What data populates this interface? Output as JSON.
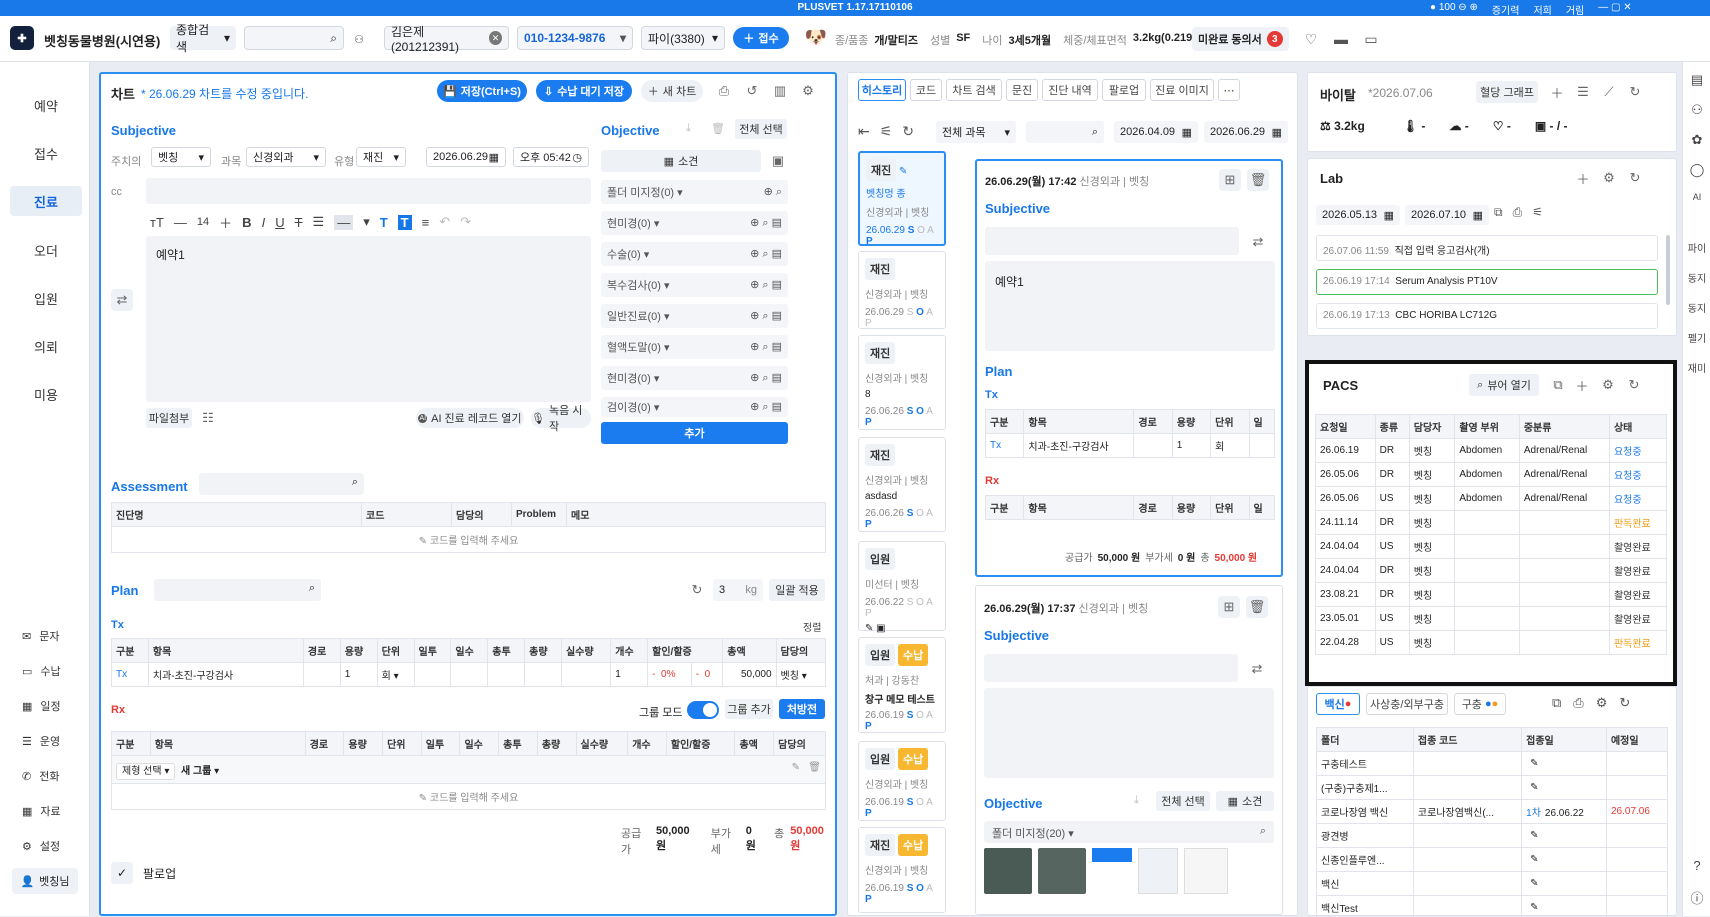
{
  "title_bar": {
    "app": "PLUSVET 1.17.17110106",
    "zoom": "100",
    "items": [
      "증기력",
      "저희",
      "거림"
    ]
  },
  "top": {
    "hospital": "벳칭동물병원(시연용)",
    "search_scope": "종합검색",
    "client": "김은제(201212391)",
    "phone": "010-1234-9876",
    "pet": "파이(3380)",
    "reception_btn": "접수",
    "species_label": "종/품종",
    "species": "개/말티즈",
    "sex_label": "성별",
    "sex": "SF",
    "age_label": "나이",
    "age": "3세5개월",
    "weight_label": "체중/체표면적",
    "weight": "3.2kg(0.219)",
    "consent_label": "미완료 동의서",
    "consent_count": "3"
  },
  "nav": {
    "items": [
      "예약",
      "접수",
      "진료",
      "오더",
      "입원",
      "의뢰",
      "미용"
    ],
    "sub": [
      "문자",
      "수납",
      "일정",
      "운영",
      "전화",
      "자료",
      "설정"
    ],
    "user": "벳칭님"
  },
  "chart": {
    "title": "차트",
    "edit_note": "* 26.06.29 차트를 수정 중입니다.",
    "save": "저장(Ctrl+S)",
    "save_wait": "수납 대기 저장",
    "new": "새 차트",
    "subjective": "Subjective",
    "doc_label": "주치의",
    "doc": "벳칭",
    "dept_label": "과목",
    "dept": "신경외과",
    "type_label": "유형",
    "type": "재진",
    "date": "2026.06.29",
    "time": "오후 05:42",
    "cc": "cc",
    "font_size": "14",
    "body": "예약1",
    "attach": "파일첨부",
    "ai_btn": "AI 진료 레코드 열기",
    "rec_btn": "녹음 시작",
    "objective": "Objective",
    "select_all": "전체 선택",
    "findings": "소견",
    "obj_rows": [
      "폴더 미지정(0)",
      "현미경(0)",
      "수술(0)",
      "복수검사(0)",
      "일반진료(0)",
      "혈액도말(0)",
      "현미경(0)",
      "검이경(0)"
    ],
    "add": "추가",
    "assessment": "Assessment",
    "a_cols": [
      "진단명",
      "코드",
      "담당의",
      "Problem",
      "메모"
    ],
    "a_placeholder": "코드를 입력해 주세요",
    "plan": "Plan",
    "plan_kg_val": "3",
    "plan_kg": "kg",
    "bulk": "일괄 적용",
    "tx": "Tx",
    "sort": "정렬",
    "tx_cols": [
      "구분",
      "항목",
      "경로",
      "용량",
      "단위",
      "일투",
      "일수",
      "총투",
      "총량",
      "실수량",
      "개수",
      "할인/할증",
      "총액",
      "담당의"
    ],
    "tx_row": {
      "type": "Tx",
      "item": "치과-초진-구강검사",
      "qty": "1",
      "unit": "회",
      "count": "1",
      "disc1": "-",
      "disc1_v": "0%",
      "disc2": "-",
      "disc2_v": "0",
      "total": "50,000",
      "doctor": "벳칭"
    },
    "rx": "Rx",
    "group_mode": "그룹 모드",
    "group_add": "그룹 추가",
    "prescription": "처방전",
    "rx_cols": [
      "구분",
      "항목",
      "경로",
      "용량",
      "단위",
      "일투",
      "일수",
      "총투",
      "총량",
      "실수량",
      "개수",
      "할인/할증",
      "총액",
      "담당의"
    ],
    "rx_group_sel": "제형 선택",
    "rx_group": "새 그룹",
    "rx_placeholder": "코드를 입력해 주세요",
    "supply_label": "공급가",
    "supply": "50,000 원",
    "vat_label": "부가세",
    "vat": "0 원",
    "total_label": "총",
    "total": "50,000 원",
    "followup": "팔로업"
  },
  "history": {
    "tabs": [
      "히스토리",
      "코드",
      "차트 검색",
      "문진",
      "진단 내역",
      "팔로업",
      "진료 이미지"
    ],
    "dept_filter": "전체 과목",
    "from": "2026.04.09",
    "to": "2026.06.29",
    "cards": [
      {
        "badge": "재진",
        "badge2": "",
        "line1": "벳칭멍 종",
        "line2": "신경외과 | 벳칭",
        "line3": "",
        "date": "26.06.29"
      },
      {
        "badge": "재진",
        "badge2": "",
        "line1": "신경외과 | 벳칭",
        "line2": "",
        "line3": "",
        "date": "26.06.29"
      },
      {
        "badge": "재진",
        "badge2": "",
        "line1": "신경외과 | 벳칭",
        "line2": "8",
        "line3": "",
        "date": "26.06.26"
      },
      {
        "badge": "재진",
        "badge2": "",
        "line1": "신경외과 | 벳칭",
        "line2": "asdasd",
        "line3": "",
        "date": "26.06.26"
      },
      {
        "badge": "입원",
        "badge2": "",
        "line1": "미선터 | 벳칭",
        "line2": "",
        "line3": "",
        "date": "26.06.22"
      },
      {
        "badge": "입원",
        "badge2": "수납",
        "line1": "처과 | 강동찬",
        "line2": "창구 메모 테스트",
        "line3": "",
        "date": "26.06.19"
      },
      {
        "badge": "입원",
        "badge2": "수납",
        "line1": "신경외과 | 벳칭",
        "line2": "",
        "line3": "",
        "date": "26.06.19"
      },
      {
        "badge": "재진",
        "badge2": "수납",
        "line1": "신경외과 | 벳칭",
        "line2": "",
        "line3": "",
        "date": "26.06.19"
      }
    ],
    "entry1": {
      "date": "26.06.29(월) 17:42",
      "dept": "신경외과 | 벳칭",
      "subjective": "Subjective",
      "body": "예약1",
      "plan": "Plan",
      "tx": "Tx",
      "cols": [
        "구분",
        "항목",
        "경로",
        "용량",
        "단위",
        "일"
      ],
      "row": [
        "Tx",
        "치과-초진-구강검사",
        "",
        "1",
        "회",
        ""
      ],
      "rx": "Rx",
      "rx_cols": [
        "구분",
        "항목",
        "경로",
        "용량",
        "단위",
        "일"
      ],
      "supply_label": "공급가",
      "supply": "50,000 원",
      "vat_label": "부가세",
      "vat": "0 원",
      "total_label": "총",
      "total": "50,000 원"
    },
    "entry2": {
      "date": "26.06.29(월) 17:37",
      "dept": "신경외과 | 벳칭",
      "subjective": "Subjective",
      "objective": "Objective",
      "select_all": "전체 선택",
      "findings": "소견",
      "folder": "폴더 미지정(20)"
    }
  },
  "vital": {
    "title": "바이탈",
    "date": "*2026.07.06",
    "graph": "혈당 그래프",
    "weight": "3.2kg",
    "temp": "-",
    "resp": "-",
    "heart": "-",
    "bp": "- / -"
  },
  "lab": {
    "title": "Lab",
    "from": "2026.05.13",
    "to": "2026.07.10",
    "rows": [
      {
        "date": "26.07.06 11:59",
        "text": "직접 입력  응고검사(개)"
      },
      {
        "date": "26.06.19 17:14",
        "text": "Serum Analysis  PT10V"
      },
      {
        "date": "26.06.19 17:13",
        "text": "CBC  HORIBA LC712G"
      }
    ]
  },
  "pacs": {
    "title": "PACS",
    "viewer": "뷰어 열기",
    "cols": [
      "요청일",
      "종류",
      "담당자",
      "촬영 부위",
      "중분류",
      "상태"
    ],
    "rows": [
      {
        "date": "26.06.19",
        "kind": "DR",
        "by": "벳칭",
        "part": "Abdomen",
        "cat": "Adrenal/Renal",
        "status": "요청중",
        "color": "blue"
      },
      {
        "date": "26.05.06",
        "kind": "DR",
        "by": "벳칭",
        "part": "Abdomen",
        "cat": "Adrenal/Renal",
        "status": "요청중",
        "color": "blue"
      },
      {
        "date": "26.05.06",
        "kind": "US",
        "by": "벳칭",
        "part": "Abdomen",
        "cat": "Adrenal/Renal",
        "status": "요청중",
        "color": "blue"
      },
      {
        "date": "24.11.14",
        "kind": "DR",
        "by": "벳칭",
        "part": "",
        "cat": "",
        "status": "판독완료",
        "color": "orange"
      },
      {
        "date": "24.04.04",
        "kind": "US",
        "by": "벳칭",
        "part": "",
        "cat": "",
        "status": "촬영완료",
        "color": "gray"
      },
      {
        "date": "24.04.04",
        "kind": "DR",
        "by": "벳칭",
        "part": "",
        "cat": "",
        "status": "촬영완료",
        "color": "gray"
      },
      {
        "date": "23.08.21",
        "kind": "DR",
        "by": "벳칭",
        "part": "",
        "cat": "",
        "status": "촬영완료",
        "color": "gray"
      },
      {
        "date": "23.05.01",
        "kind": "US",
        "by": "벳칭",
        "part": "",
        "cat": "",
        "status": "촬영완료",
        "color": "gray"
      },
      {
        "date": "22.04.28",
        "kind": "US",
        "by": "벳칭",
        "part": "",
        "cat": "",
        "status": "판독완료",
        "color": "orange"
      }
    ]
  },
  "vaccine": {
    "tabs": [
      "백신",
      "사상충/외부구충",
      "구충"
    ],
    "cols": [
      "폴더",
      "접종 코드",
      "접종일",
      "예정일"
    ],
    "rows": [
      {
        "name": "구충테스트",
        "code": "",
        "dose": "",
        "date": "",
        "due": ""
      },
      {
        "name": "(구충)구충제1...",
        "code": "",
        "dose": "",
        "date": "",
        "due": ""
      },
      {
        "name": "코로나장염 백신",
        "code": "코로나장염백신(...",
        "dose": "1차",
        "date": "26.06.22",
        "due": "26.07.06"
      },
      {
        "name": "광견병",
        "code": "",
        "dose": "",
        "date": "",
        "due": ""
      },
      {
        "name": "신종인플루엔...",
        "code": "",
        "dose": "",
        "date": "",
        "due": ""
      },
      {
        "name": "백신",
        "code": "",
        "dose": "",
        "date": "",
        "due": ""
      },
      {
        "name": "백신Test",
        "code": "",
        "dose": "",
        "date": "",
        "due": ""
      }
    ]
  },
  "rightbar": [
    "파이",
    "동지",
    "동지",
    "펠기",
    "재미"
  ]
}
